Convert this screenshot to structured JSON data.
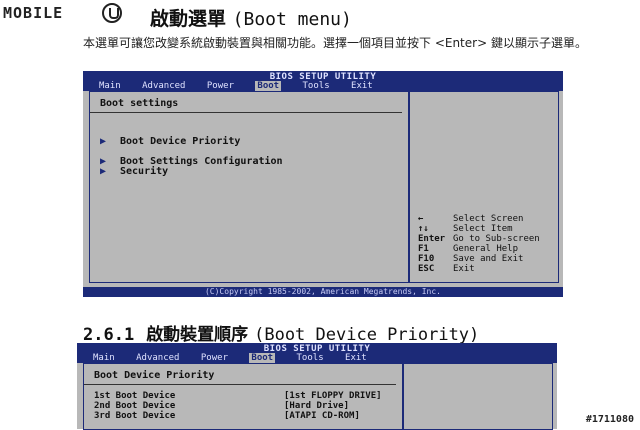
{
  "logo": {
    "text": "MOBILE"
  },
  "page": {
    "title_zh": "啟動選單",
    "title_en": "(Boot menu)",
    "intro": "本選單可讓您改變系統啟動裝置與相關功能。選擇一個項目並按下 <Enter> 鍵以顯示子選單。"
  },
  "bios1": {
    "utility_title": "BIOS SETUP UTILITY",
    "tabs": [
      "Main",
      "Advanced",
      "Power",
      "Boot",
      "Tools",
      "Exit"
    ],
    "active_tab": "Boot",
    "section_title": "Boot settings",
    "items": [
      {
        "label": "Boot Device Priority"
      },
      {
        "label": "Boot Settings Configuration"
      },
      {
        "label": "Security"
      }
    ],
    "keys": [
      {
        "key": "←",
        "desc": "Select Screen"
      },
      {
        "key": "↑↓",
        "desc": "Select Item"
      },
      {
        "key": "Enter",
        "desc": "Go to Sub-screen"
      },
      {
        "key": "F1",
        "desc": "General Help"
      },
      {
        "key": "F10",
        "desc": "Save and Exit"
      },
      {
        "key": "ESC",
        "desc": "Exit"
      }
    ],
    "copyright": "(C)Copyright 1985-2002, American Megatrends, Inc."
  },
  "section2": {
    "number": "2.6.1",
    "title_zh": "啟動裝置順序",
    "title_en": "(Boot Device Priority)"
  },
  "bios2": {
    "utility_title": "BIOS SETUP UTILITY",
    "tabs": [
      "Main",
      "Advanced",
      "Power",
      "Boot",
      "Tools",
      "Exit"
    ],
    "section_title": "Boot Device Priority",
    "devices": [
      {
        "label": "1st Boot Device",
        "value": "[1st FLOPPY DRIVE]"
      },
      {
        "label": "2nd Boot Device",
        "value": "[Hard Drive]"
      },
      {
        "label": "3rd Boot Device",
        "value": "[ATAPI CD-ROM]"
      }
    ]
  },
  "watermark": "#1711080"
}
